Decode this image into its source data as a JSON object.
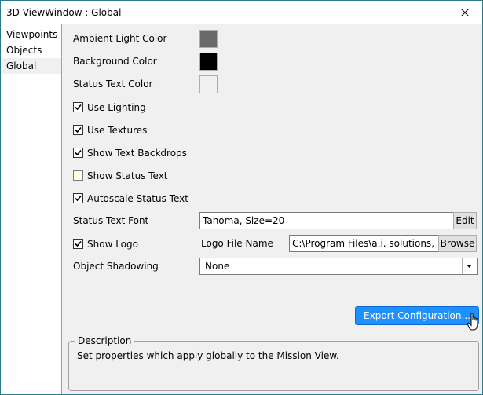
{
  "window": {
    "title": "3D ViewWindow : Global"
  },
  "sidebar": {
    "items": [
      {
        "label": "Viewpoints"
      },
      {
        "label": "Objects"
      },
      {
        "label": "Global"
      }
    ]
  },
  "global": {
    "ambient_light_label": "Ambient Light Color",
    "ambient_light_color": "#6a6a6a",
    "background_label": "Background Color",
    "background_color": "#000000",
    "status_text_color_label": "Status Text Color",
    "status_text_color": "#f0f0f0",
    "use_lighting": {
      "label": "Use Lighting",
      "checked": true
    },
    "use_textures": {
      "label": "Use Textures",
      "checked": true
    },
    "show_text_backdrops": {
      "label": "Show Text Backdrops",
      "checked": true
    },
    "show_status_text": {
      "label": "Show Status Text",
      "checked": false
    },
    "autoscale_status_text": {
      "label": "Autoscale Status Text",
      "checked": true
    },
    "status_text_font_label": "Status Text Font",
    "status_text_font_value": "Tahoma, Size=20",
    "edit_button": "Edit",
    "show_logo": {
      "label": "Show Logo",
      "checked": true
    },
    "logo_file_label": "Logo File Name",
    "logo_file_value": "C:\\Program Files\\a.i. solutions, Inc\\",
    "browse_button": "Browse",
    "object_shadowing_label": "Object Shadowing",
    "object_shadowing_value": "None",
    "export_button": "Export Configuration..."
  },
  "description": {
    "legend": "Description",
    "text": "Set properties which apply globally to the Mission View."
  },
  "icons": {
    "close": "close-icon",
    "check": "check-icon",
    "dropdown": "chevron-down-icon",
    "cursor": "hand-pointer-icon"
  },
  "colors": {
    "accent": "#1e90ff",
    "window_border": "#2b7a8a"
  }
}
